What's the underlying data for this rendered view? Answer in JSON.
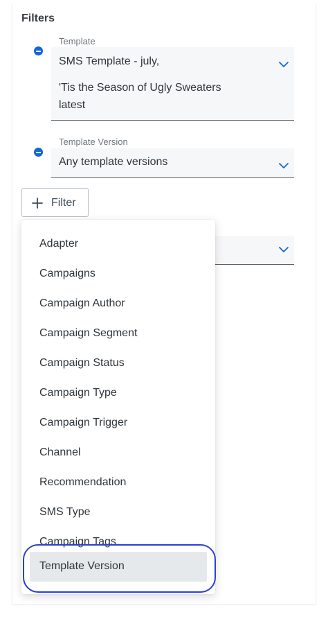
{
  "panel": {
    "title": "Filters"
  },
  "filters": [
    {
      "label": "Template",
      "lines": [
        "SMS Template - july,",
        "'Tis the Season of Ugly Sweaters",
        "latest"
      ]
    },
    {
      "label": "Template Version",
      "lines": [
        "Any template versions"
      ]
    }
  ],
  "add_filter": {
    "label": "Filter"
  },
  "menu": {
    "items": [
      "Adapter",
      "Campaigns",
      "Campaign Author",
      "Campaign Segment",
      "Campaign Status",
      "Campaign Type",
      "Campaign Trigger",
      "Channel",
      "Recommendation",
      "SMS Type",
      "Campaign Tags",
      "Template Version"
    ],
    "selected": "Template Version"
  },
  "colors": {
    "accent": "#1266d9",
    "highlight_ring": "#2a3fd1",
    "selected_bg": "#e6e9ec"
  },
  "icons": {
    "remove": "minus-circle-icon",
    "chevron": "chevron-down-icon",
    "add": "plus-icon"
  }
}
